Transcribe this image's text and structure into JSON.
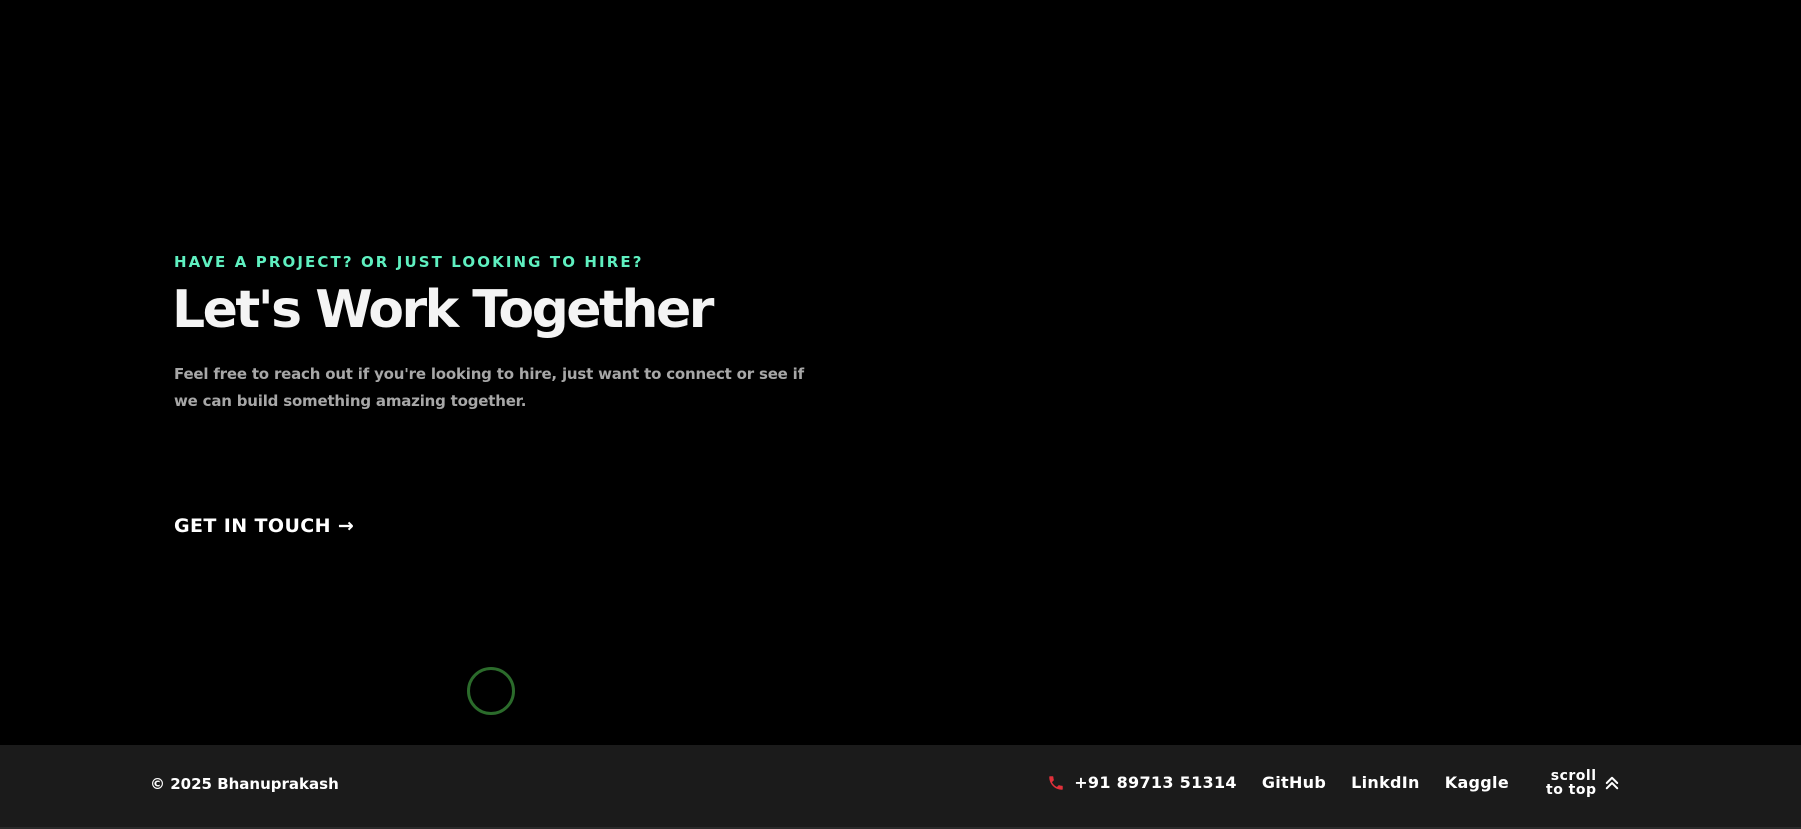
{
  "hero": {
    "eyebrow": "HAVE A PROJECT? OR JUST LOOKING TO HIRE?",
    "headline": "Let's Work Together",
    "description": "Feel free to reach out if you're looking to hire, just want to connect or see if we can build something amazing together.",
    "cta_label": "GET IN TOUCH →"
  },
  "footer": {
    "copyright": "© 2025 Bhanuprakash",
    "phone": "+91 89713 51314",
    "links": [
      {
        "label": "GitHub"
      },
      {
        "label": "LinkdIn"
      },
      {
        "label": "Kaggle"
      }
    ],
    "scroll_to_top_line1": "scroll",
    "scroll_to_top_line2": "to top"
  },
  "icons": {
    "phone": "phone-icon",
    "scroll": "double-chevron-up-icon",
    "cursor": "cursor-ring-icon"
  },
  "colors": {
    "background": "#000000",
    "footer_background": "#1b1b1b",
    "accent": "#5ff0c0",
    "phone_icon": "#e0303a",
    "cursor_ring": "#2b6b2b",
    "description_text": "#a7a7a7"
  }
}
